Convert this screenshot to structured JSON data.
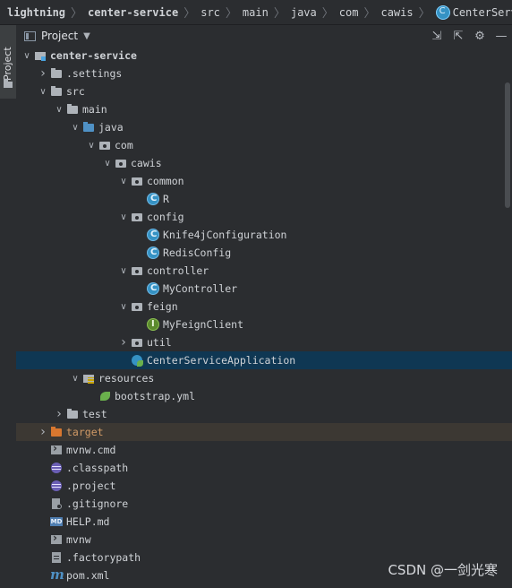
{
  "breadcrumb": {
    "items": [
      "lightning",
      "center-service",
      "src",
      "main",
      "java",
      "com",
      "cawis",
      "CenterServiceApplica"
    ]
  },
  "side_tab": {
    "label": "Project"
  },
  "toolbar": {
    "title": "Project"
  },
  "tree": [
    {
      "label": "center-service",
      "depth": 1,
      "arrow": "down",
      "icon": "module",
      "bold": true
    },
    {
      "label": ".settings",
      "depth": 2,
      "arrow": "right",
      "icon": "folder"
    },
    {
      "label": "src",
      "depth": 2,
      "arrow": "down",
      "icon": "folder"
    },
    {
      "label": "main",
      "depth": 3,
      "arrow": "down",
      "icon": "folder"
    },
    {
      "label": "java",
      "depth": 4,
      "arrow": "down",
      "icon": "folder-blue"
    },
    {
      "label": "com",
      "depth": 5,
      "arrow": "down",
      "icon": "pkg"
    },
    {
      "label": "cawis",
      "depth": 6,
      "arrow": "down",
      "icon": "pkg"
    },
    {
      "label": "common",
      "depth": 7,
      "arrow": "down",
      "icon": "pkg"
    },
    {
      "label": "R",
      "depth": 8,
      "arrow": "",
      "icon": "class"
    },
    {
      "label": "config",
      "depth": 7,
      "arrow": "down",
      "icon": "pkg"
    },
    {
      "label": "Knife4jConfiguration",
      "depth": 8,
      "arrow": "",
      "icon": "class"
    },
    {
      "label": "RedisConfig",
      "depth": 8,
      "arrow": "",
      "icon": "class"
    },
    {
      "label": "controller",
      "depth": 7,
      "arrow": "down",
      "icon": "pkg"
    },
    {
      "label": "MyController",
      "depth": 8,
      "arrow": "",
      "icon": "class"
    },
    {
      "label": "feign",
      "depth": 7,
      "arrow": "down",
      "icon": "pkg"
    },
    {
      "label": "MyFeignClient",
      "depth": 8,
      "arrow": "",
      "icon": "interface"
    },
    {
      "label": "util",
      "depth": 7,
      "arrow": "right",
      "icon": "pkg"
    },
    {
      "label": "CenterServiceApplication",
      "depth": 7,
      "arrow": "",
      "icon": "spring",
      "selected": true
    },
    {
      "label": "resources",
      "depth": 4,
      "arrow": "down",
      "icon": "res"
    },
    {
      "label": "bootstrap.yml",
      "depth": 5,
      "arrow": "",
      "icon": "yml"
    },
    {
      "label": "test",
      "depth": 3,
      "arrow": "right",
      "icon": "folder"
    },
    {
      "label": "target",
      "depth": 2,
      "arrow": "right",
      "icon": "folder-orange",
      "excluded": true
    },
    {
      "label": "mvnw.cmd",
      "depth": 2,
      "arrow": "",
      "icon": "cmd"
    },
    {
      "label": ".classpath",
      "depth": 2,
      "arrow": "",
      "icon": "eclipse"
    },
    {
      "label": ".project",
      "depth": 2,
      "arrow": "",
      "icon": "eclipse"
    },
    {
      "label": ".gitignore",
      "depth": 2,
      "arrow": "",
      "icon": "git"
    },
    {
      "label": "HELP.md",
      "depth": 2,
      "arrow": "",
      "icon": "md"
    },
    {
      "label": "mvnw",
      "depth": 2,
      "arrow": "",
      "icon": "cmd"
    },
    {
      "label": ".factorypath",
      "depth": 2,
      "arrow": "",
      "icon": "file"
    },
    {
      "label": "pom.xml",
      "depth": 2,
      "arrow": "",
      "icon": "maven"
    }
  ],
  "watermark": "CSDN @一剑光寒",
  "colors": {
    "background": "#2b2d30",
    "selected_row": "#0f3753",
    "excluded_row": "#3c3833",
    "class_icon": "#3592c4",
    "interface_icon": "#5c8a2e"
  }
}
